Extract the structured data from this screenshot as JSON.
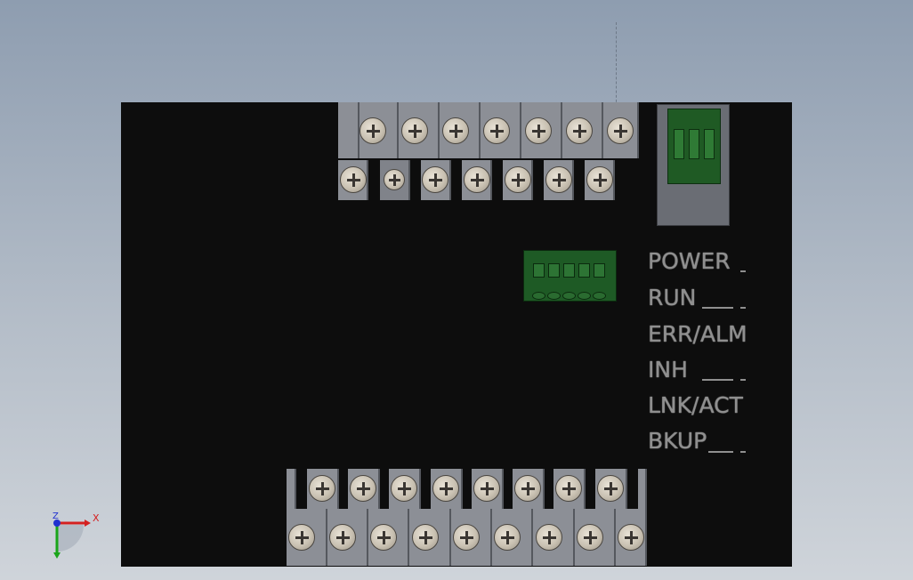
{
  "leds": [
    {
      "id": "power",
      "label": "POWER"
    },
    {
      "id": "run",
      "label": "RUN"
    },
    {
      "id": "err",
      "label": "ERR/ALM"
    },
    {
      "id": "inh",
      "label": "INH"
    },
    {
      "id": "lnk",
      "label": "LNK/ACT"
    },
    {
      "id": "bkup",
      "label": "BKUP"
    }
  ],
  "triad": {
    "x": "X",
    "z": "Z"
  },
  "colors": {
    "panel": "#0d0d0d",
    "terminal": "#8c8f96",
    "connector_green": "#1e5a25",
    "axis_x": "#d42020",
    "axis_y": "#1aa51a",
    "axis_z": "#2030d0"
  }
}
